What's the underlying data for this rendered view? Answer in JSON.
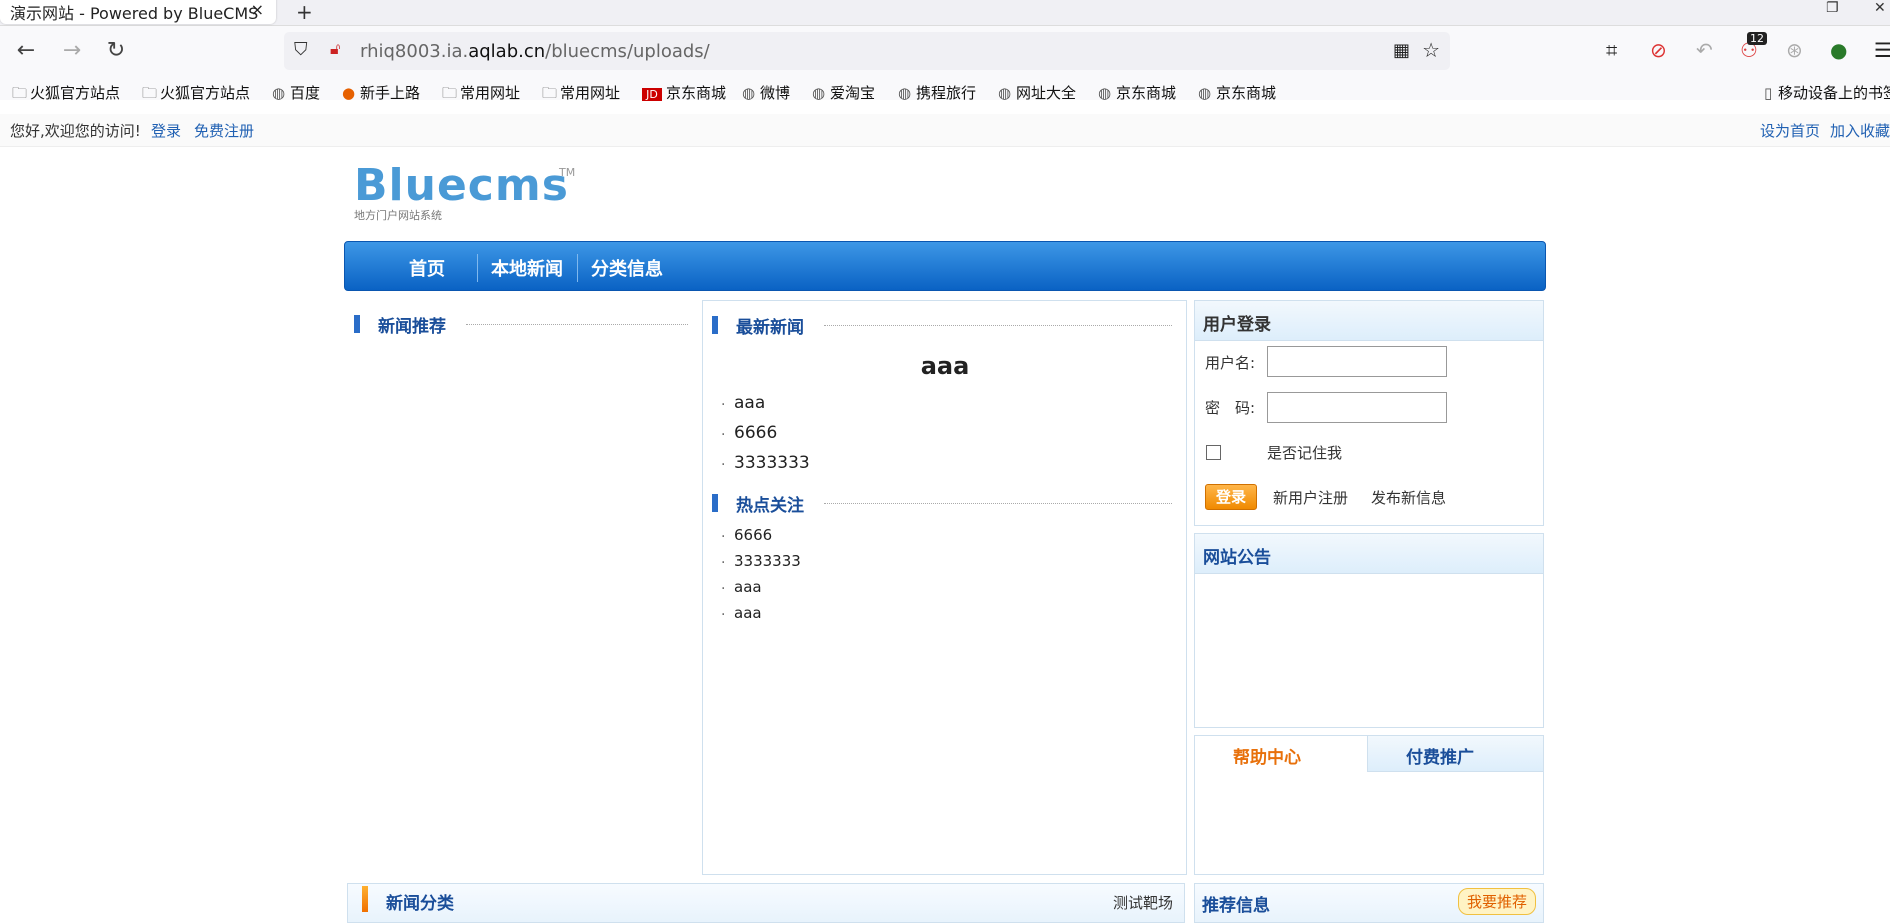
{
  "browser": {
    "tab_title": "演示网站 - Powered by BlueCMS",
    "tab_close": "×",
    "new_tab": "+",
    "url_host_prefix": "rhiq8003.ia.",
    "url_host_main": "aqlab.cn",
    "url_path": "/bluecms/uploads/",
    "extension_badge": "12",
    "bookmarks": [
      {
        "label": "火狐官方站点",
        "icon": "folder-icon"
      },
      {
        "label": "火狐官方站点",
        "icon": "folder-icon"
      },
      {
        "label": "百度",
        "icon": "globe-icon"
      },
      {
        "label": "新手上路",
        "icon": "firefox-icon"
      },
      {
        "label": "常用网址",
        "icon": "folder-icon"
      },
      {
        "label": "常用网址",
        "icon": "folder-icon"
      },
      {
        "label": "京东商城",
        "icon": "jd-icon"
      },
      {
        "label": "微博",
        "icon": "globe-icon"
      },
      {
        "label": "爱淘宝",
        "icon": "globe-icon"
      },
      {
        "label": "携程旅行",
        "icon": "globe-icon"
      },
      {
        "label": "网址大全",
        "icon": "globe-icon"
      },
      {
        "label": "京东商城",
        "icon": "globe-icon"
      },
      {
        "label": "京东商城",
        "icon": "globe-icon"
      }
    ],
    "mobile_bookmarks": "移动设备上的书签"
  },
  "site_top": {
    "welcome": "您好,欢迎您的访问!",
    "login": "登录",
    "register": "免费注册",
    "set_home": "设为首页",
    "add_fav": "加入收藏"
  },
  "logo": {
    "name": "Bluecms",
    "tm": "TM",
    "sub": "地方门户网站系统"
  },
  "mainnav": [
    "首页",
    "本地新闻",
    "分类信息"
  ],
  "left": {
    "title": "新闻推荐"
  },
  "center": {
    "latest_title": "最新新闻",
    "headline": "aaa",
    "latest": [
      "aaa",
      "6666",
      "3333333"
    ],
    "hot_title": "热点关注",
    "hot": [
      "6666",
      "3333333",
      "aaa",
      "aaa"
    ]
  },
  "login": {
    "title": "用户登录",
    "username_label": "用户名:",
    "password_label": "密　码:",
    "remember": "是否记住我",
    "submit": "登录",
    "new_register": "新用户注册",
    "publish": "发布新信息"
  },
  "notice": {
    "title": "网站公告"
  },
  "help_tabs": [
    "帮助中心",
    "付费推广"
  ],
  "bottom": {
    "news_category": "新闻分类",
    "test_range": "测试靶场",
    "recommend": "推荐信息",
    "recommend_btn": "我要推荐"
  },
  "colors": {
    "nav_blue": "#0a62c4",
    "active_tab": "#e8700a"
  }
}
